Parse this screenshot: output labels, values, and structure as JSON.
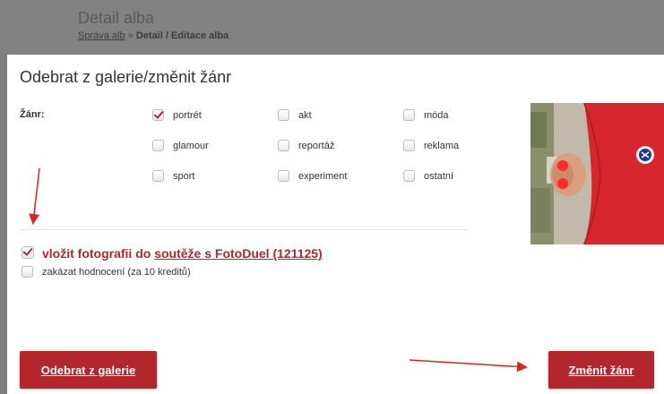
{
  "background_page": {
    "title": "Detail alba",
    "breadcrumb_link": "Správa alb",
    "breadcrumb_sep": "»",
    "breadcrumb_current": "Detail / Editace alba"
  },
  "modal": {
    "title": "Odebrat z galerie/změnit žánr",
    "genre_label": "Žánr:",
    "genres": [
      {
        "label": "portrét",
        "checked": true
      },
      {
        "label": "akt",
        "checked": false
      },
      {
        "label": "móda",
        "checked": false
      },
      {
        "label": "glamour",
        "checked": false
      },
      {
        "label": "reportáž",
        "checked": false
      },
      {
        "label": "reklama",
        "checked": false
      },
      {
        "label": "sport",
        "checked": false
      },
      {
        "label": "experiment",
        "checked": false
      },
      {
        "label": "ostatní",
        "checked": false
      }
    ],
    "contest": {
      "prefix": "vložit fotografii do ",
      "link": "soutěže s FotoDuel (121125)",
      "checked": true
    },
    "disable_rating": {
      "label": "zakázat hodnocení (za 10 kreditů)",
      "checked": false
    },
    "buttons": {
      "remove": "Odebrat z galerie",
      "change": "Změnit žánr"
    }
  },
  "colors": {
    "accent": "#b3262b",
    "overlay": "#7d7d7d",
    "annotation_arrow": "#e02020"
  }
}
